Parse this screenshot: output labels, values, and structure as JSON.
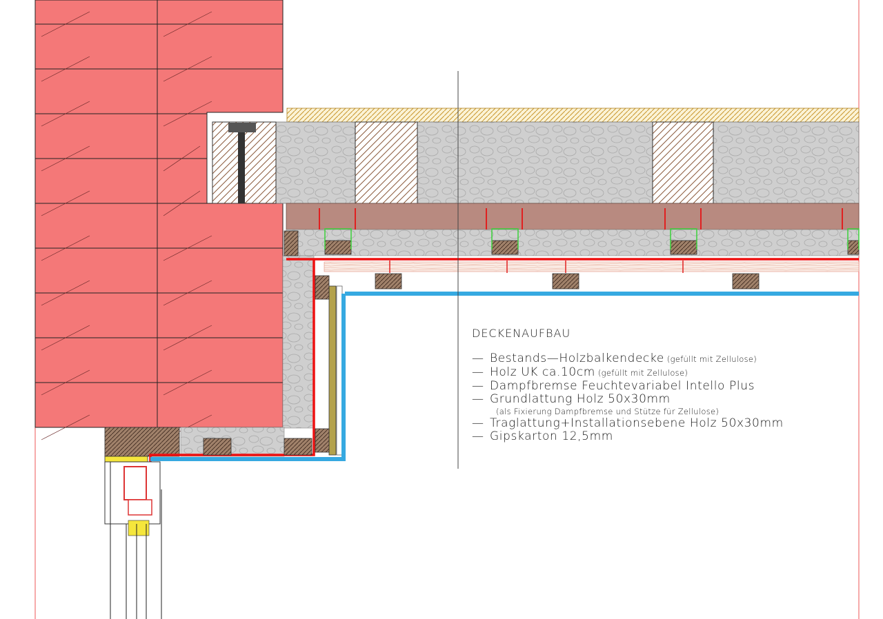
{
  "legend": {
    "heading": "DECKENAUFBAU",
    "items": [
      {
        "text": "Bestands—Holzbalkendecke",
        "note": "(gefüllt mit Zellulose)"
      },
      {
        "text": "Holz UK ca.10cm",
        "note": "(gefüllt mit Zellulose)"
      },
      {
        "text": "Dampfbremse Feuchtevariabel Intello Plus",
        "note": ""
      },
      {
        "text": "Grundlattung Holz 50x30mm",
        "note": ""
      },
      {
        "sub": "(als Fixierung Dampfbremse und Stütze für Zellulose)"
      },
      {
        "text": "Traglattung+Installationsebene Holz 50x30mm",
        "note": ""
      },
      {
        "text": "Gipskarton 12,5mm",
        "note": ""
      }
    ],
    "dash": "—"
  },
  "colors": {
    "masonry": "#f47878",
    "insulation": "#cfcfcf",
    "timber_board": "#b07a6e",
    "vapour_barrier": "#ee1111",
    "drywall": "#36a9e1",
    "screed_hatch": "#d4a73a",
    "batten": "#8b6a4e",
    "frame_line": "#ee5555"
  }
}
